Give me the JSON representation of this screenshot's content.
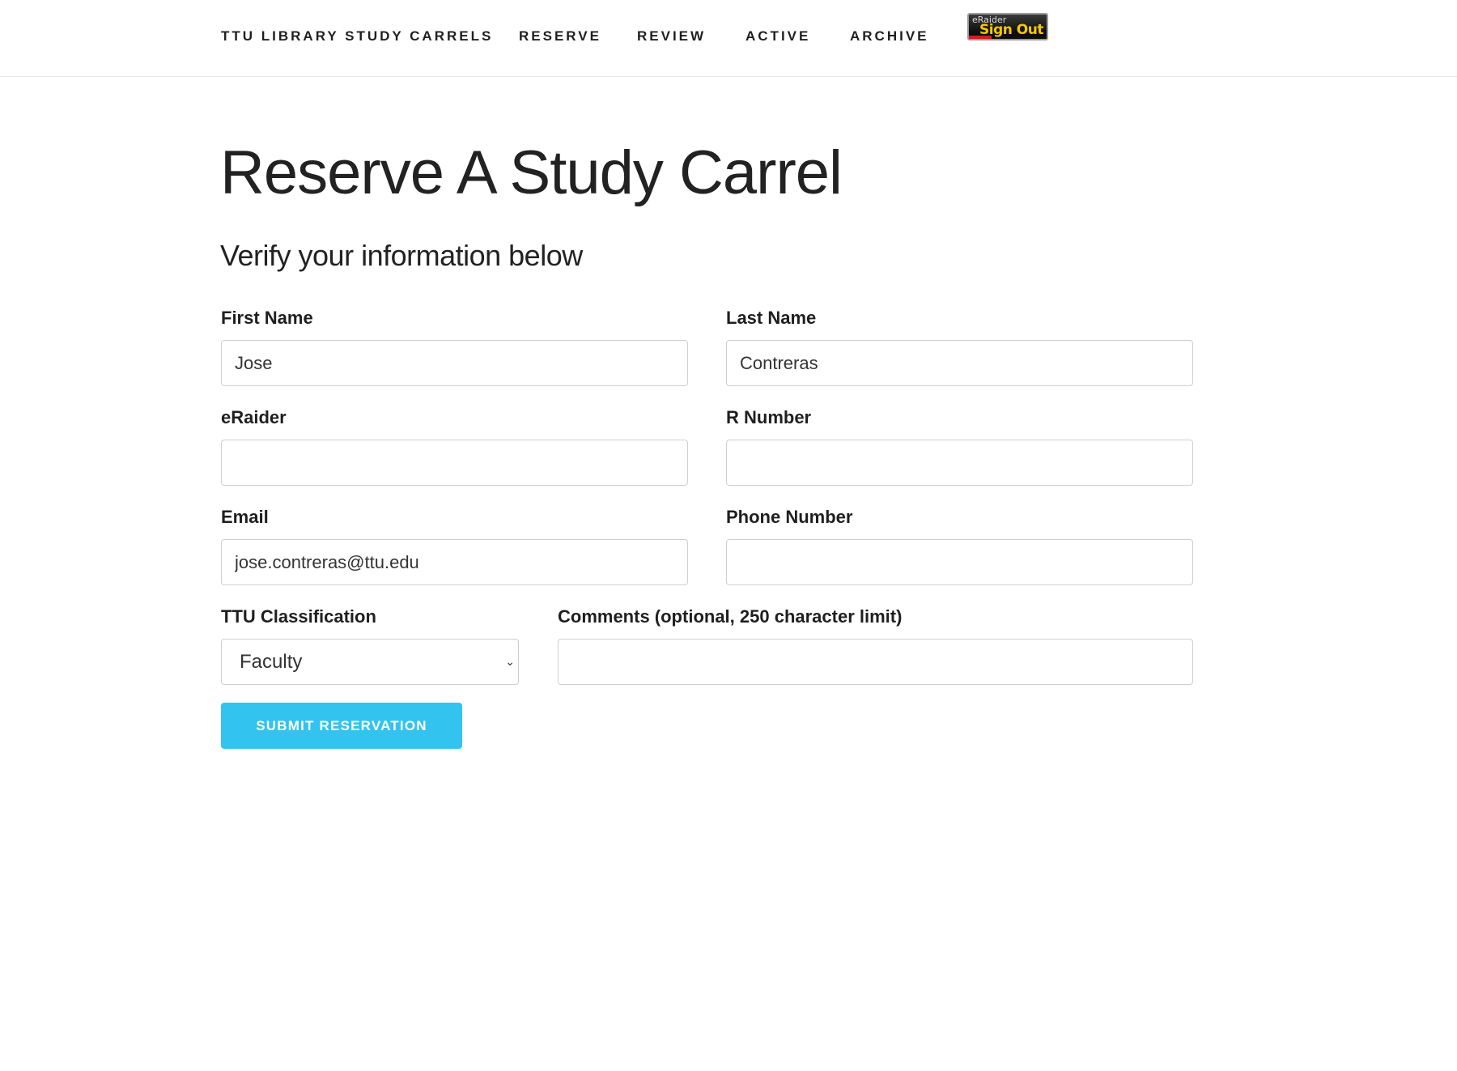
{
  "nav": {
    "brand": "TTU LIBRARY STUDY CARRELS",
    "links": [
      "RESERVE",
      "REVIEW",
      "ACTIVE",
      "ARCHIVE"
    ],
    "signout": {
      "small": "eRaider",
      "big": "Sign Out"
    }
  },
  "main": {
    "title": "Reserve A Study Carrel",
    "subtitle": "Verify your information below"
  },
  "form": {
    "first_name": {
      "label": "First Name",
      "value": "Jose"
    },
    "last_name": {
      "label": "Last Name",
      "value": "Contreras"
    },
    "eraider": {
      "label": "eRaider",
      "value": ""
    },
    "r_number": {
      "label": "R Number",
      "value": ""
    },
    "email": {
      "label": "Email",
      "value": "jose.contreras@ttu.edu"
    },
    "phone": {
      "label": "Phone Number",
      "value": ""
    },
    "classification": {
      "label": "TTU Classification",
      "value": "Faculty"
    },
    "comments": {
      "label": "Comments (optional, 250 character limit)",
      "value": ""
    },
    "submit_label": "SUBMIT RESERVATION"
  },
  "colors": {
    "accent": "#33c3ef",
    "text": "#222222",
    "border": "#cfcfcf"
  }
}
